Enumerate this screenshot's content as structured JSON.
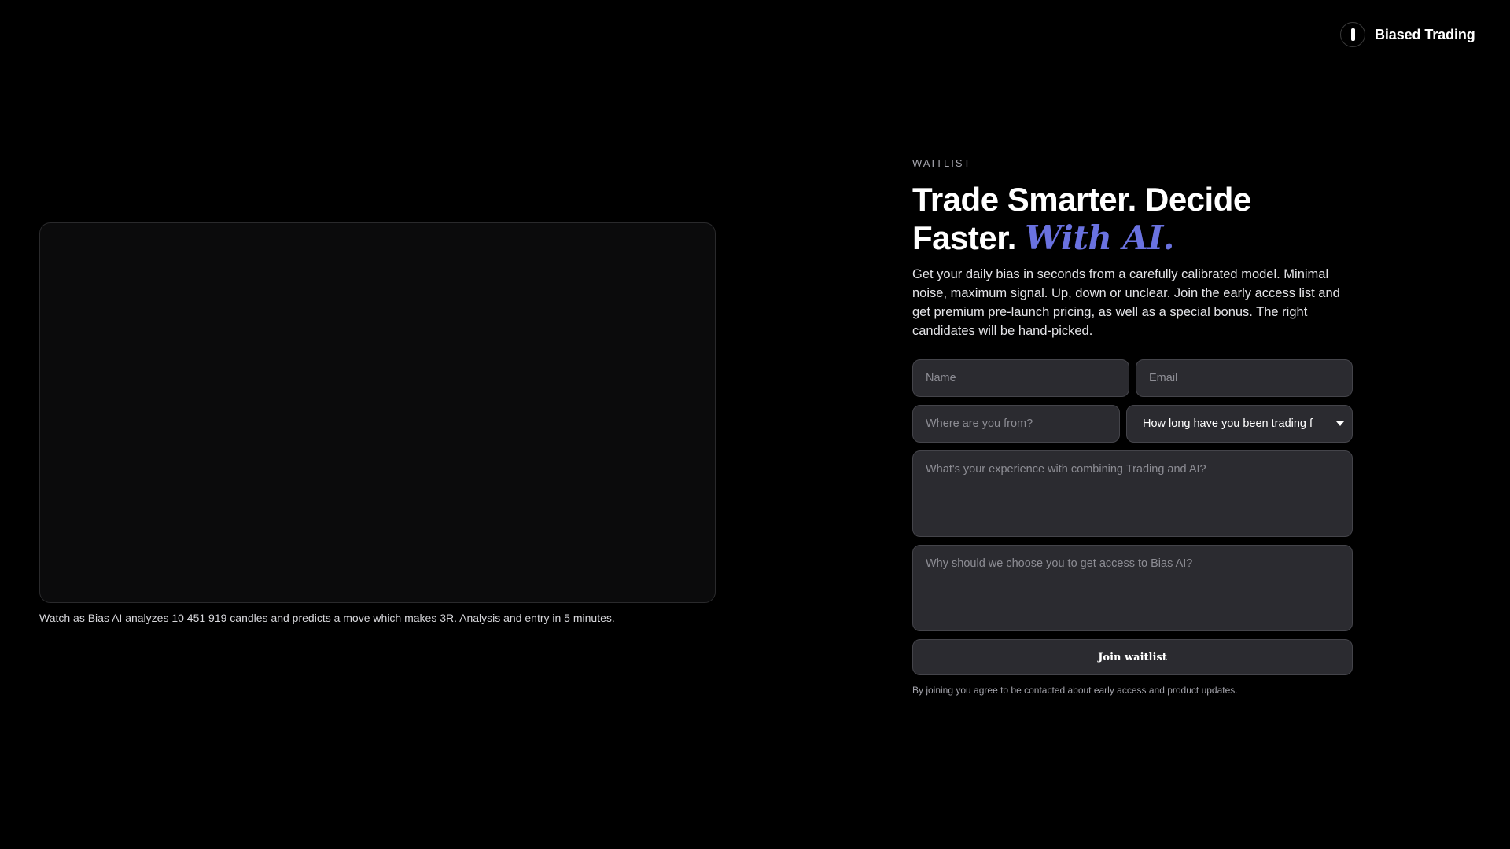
{
  "brand": {
    "name": "Biased Trading",
    "icon": "brand-logo-icon"
  },
  "video": {
    "caption": "Watch as Bias AI analyzes 10 451 919 candles and predicts a move which makes 3R. Analysis and entry in 5 minutes."
  },
  "hero": {
    "eyebrow": "WAITLIST",
    "headline_line1": "Trade Smarter. Decide",
    "headline_line2": "Faster.",
    "headline_accent": "With AI.",
    "accent_color": "#6a72e0",
    "description": "Get your daily bias in seconds from a carefully calibrated model. Minimal noise, maximum signal. Up, down or unclear. Join the early access list and get premium pre-launch pricing, as well as a special bonus. The right candidates will be hand-picked."
  },
  "form": {
    "name_placeholder": "Name",
    "email_placeholder": "Email",
    "location_placeholder": "Where are you from?",
    "trading_duration_value": "How long have you been trading f",
    "experience_placeholder": "What's your experience with combining Trading and AI?",
    "reason_placeholder": "Why should we choose you to get access to Bias AI?",
    "submit_label": "Join waitlist",
    "disclaimer": "By joining you agree to be contacted about early access and product updates."
  }
}
